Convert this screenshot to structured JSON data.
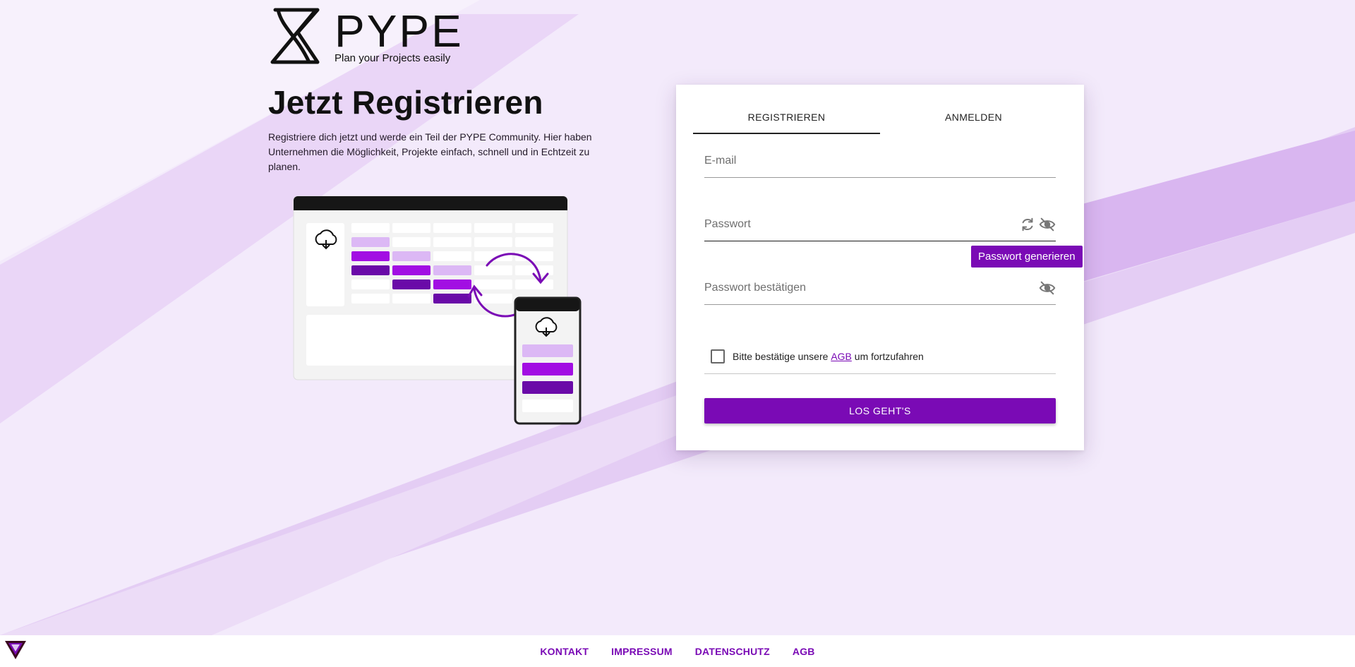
{
  "logo": {
    "word": "PYPE",
    "tagline": "Plan your Projects easily"
  },
  "hero": {
    "title": "Jetzt Registrieren",
    "text": "Registriere dich jetzt und werde ein Teil der PYPE Community. Hier haben Unternehmen die Möglichkeit, Projekte einfach, schnell und in Echtzeit zu planen."
  },
  "tabs": [
    {
      "label": "REGISTRIEREN",
      "active": true
    },
    {
      "label": "ANMELDEN",
      "active": false
    }
  ],
  "form": {
    "email": {
      "placeholder": "E-mail",
      "value": ""
    },
    "password": {
      "placeholder": "Passwort",
      "value": ""
    },
    "password_confirm": {
      "placeholder": "Passwort bestätigen",
      "value": ""
    },
    "tooltip": "Passwort generieren",
    "terms": {
      "before": "Bitte bestätige unsere ",
      "link": "AGB",
      "after": " um fortzufahren",
      "checked": false
    },
    "submit": "LOS GEHT'S"
  },
  "icons": {
    "generate": "refresh-icon",
    "toggle_visibility": "eye-off-icon",
    "upload": "cloud-download-icon"
  },
  "colors": {
    "accent": "#7a0ab5",
    "light_purple": "#dcb8f5",
    "bright_purple": "#a20ee3",
    "dark_purple": "#6a0aa8"
  },
  "footer": {
    "links": [
      "KONTAKT",
      "IMPRESSUM",
      "DATENSCHUTZ",
      "AGB"
    ]
  }
}
